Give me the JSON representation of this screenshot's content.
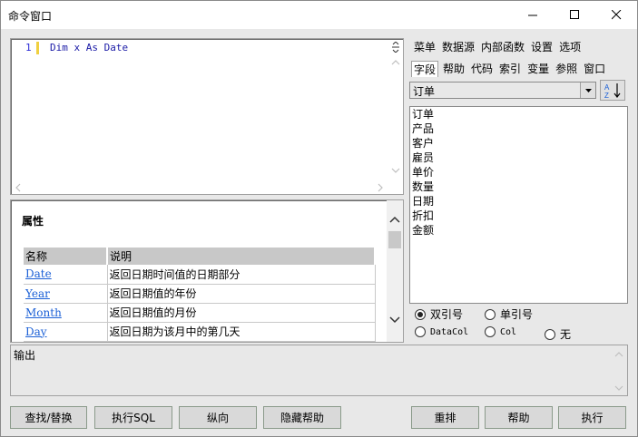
{
  "window": {
    "title": "命令窗口"
  },
  "editor": {
    "line_number": "1",
    "code": "Dim x As Date"
  },
  "properties": {
    "heading": "属性",
    "columns": [
      "名称",
      "说明"
    ],
    "rows": [
      {
        "name": "Date",
        "desc": "返回日期时间值的日期部分"
      },
      {
        "name": "Year",
        "desc": "返回日期值的年份"
      },
      {
        "name": "Month",
        "desc": "返回日期值的月份"
      },
      {
        "name": "Day",
        "desc": "返回日期为该月中的第几天"
      }
    ]
  },
  "tabs": {
    "row1": [
      "菜单",
      "数据源",
      "内部函数",
      "设置",
      "选项"
    ],
    "row2": [
      "字段",
      "帮助",
      "代码",
      "索引",
      "变量",
      "参照",
      "窗口"
    ],
    "selected": "字段"
  },
  "table_combo": {
    "value": "订单"
  },
  "fields": [
    "订单",
    "产品",
    "客户",
    "雇员",
    "单价",
    "数量",
    "日期",
    "折扣",
    "金额"
  ],
  "quote_options": {
    "double": "双引号",
    "single": "单引号",
    "datacol": "DataCol",
    "col": "Col",
    "none": "无",
    "selected_quote": "双引号"
  },
  "output": {
    "label": "输出"
  },
  "buttons": {
    "find_replace": "查找/替换",
    "exec_sql": "执行SQL",
    "vertical": "纵向",
    "hide_help": "隐藏帮助",
    "rearrange": "重排",
    "help": "帮助",
    "execute": "执行"
  }
}
